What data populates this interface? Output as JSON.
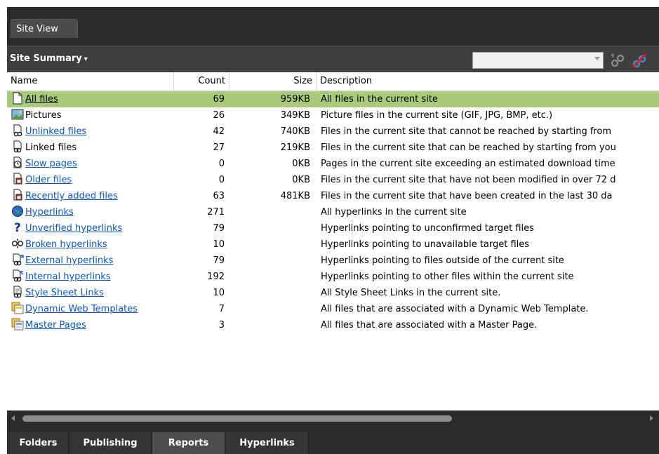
{
  "window": {
    "tab_title": "Site View"
  },
  "toolbar": {
    "summary_label": "Site Summary",
    "combo_value": "",
    "icons": [
      "verify-hyperlinks-icon",
      "edit-hyperlink-icon"
    ]
  },
  "columns": {
    "name": "Name",
    "count": "Count",
    "size": "Size",
    "description": "Description"
  },
  "rows": [
    {
      "icon": "file-icon",
      "name": "All files",
      "link": true,
      "count": "69",
      "size": "959KB",
      "description": "All files in the current site"
    },
    {
      "icon": "picture-icon",
      "name": "Pictures",
      "link": false,
      "count": "26",
      "size": "349KB",
      "description": "Picture files in the current site (GIF, JPG, BMP, etc.)"
    },
    {
      "icon": "unlinked-files-icon",
      "name": "Unlinked files",
      "link": true,
      "count": "42",
      "size": "740KB",
      "description": "Files in the current site that cannot be reached by starting from"
    },
    {
      "icon": "linked-files-icon",
      "name": "Linked files",
      "link": false,
      "count": "27",
      "size": "219KB",
      "description": "Files in the current site that can be reached by starting from you"
    },
    {
      "icon": "clock-icon",
      "name": "Slow pages",
      "link": true,
      "count": "0",
      "size": "0KB",
      "description": "Pages in the current site exceeding an estimated download time"
    },
    {
      "icon": "calendar-file-icon",
      "name": "Older files",
      "link": true,
      "count": "0",
      "size": "0KB",
      "description": "Files in the current site that have not been modified in over 72 d"
    },
    {
      "icon": "calendar-file-icon",
      "name": "Recently added files",
      "link": true,
      "count": "63",
      "size": "481KB",
      "description": "Files in the current site that have been created in the last 30 da"
    },
    {
      "icon": "globe-icon",
      "name": "Hyperlinks",
      "link": true,
      "count": "271",
      "size": "",
      "description": "All hyperlinks in the current site"
    },
    {
      "icon": "question-icon",
      "name": "Unverified hyperlinks",
      "link": true,
      "count": "79",
      "size": "",
      "description": "Hyperlinks pointing to unconfirmed target files"
    },
    {
      "icon": "broken-chain-icon",
      "name": "Broken hyperlinks",
      "link": true,
      "count": "10",
      "size": "",
      "description": "Hyperlinks pointing to unavailable target files"
    },
    {
      "icon": "external-link-icon",
      "name": "External hyperlinks",
      "link": true,
      "count": "79",
      "size": "",
      "description": "Hyperlinks pointing to files outside of the current site"
    },
    {
      "icon": "internal-link-icon",
      "name": "Internal hyperlinks",
      "link": true,
      "count": "192",
      "size": "",
      "description": "Hyperlinks pointing to other files within the current site"
    },
    {
      "icon": "stylesheet-link-icon",
      "name": "Style Sheet Links",
      "link": true,
      "count": "10",
      "size": "",
      "description": "All Style Sheet Links in the current site."
    },
    {
      "icon": "web-template-icon",
      "name": "Dynamic Web Templates",
      "link": true,
      "count": "7",
      "size": "",
      "description": "All files that are associated with a Dynamic Web Template."
    },
    {
      "icon": "master-page-icon",
      "name": "Master Pages",
      "link": true,
      "count": "3",
      "size": "",
      "description": "All files that are associated with a Master Page."
    }
  ],
  "bottom_tabs": [
    {
      "label": "Folders",
      "active": false
    },
    {
      "label": "Publishing",
      "active": false
    },
    {
      "label": "Reports",
      "active": true
    },
    {
      "label": "Hyperlinks",
      "active": false
    }
  ],
  "colors": {
    "selected_row": "#a9cc7c",
    "link": "#0b56c8",
    "chrome": "#2b2b2b"
  }
}
